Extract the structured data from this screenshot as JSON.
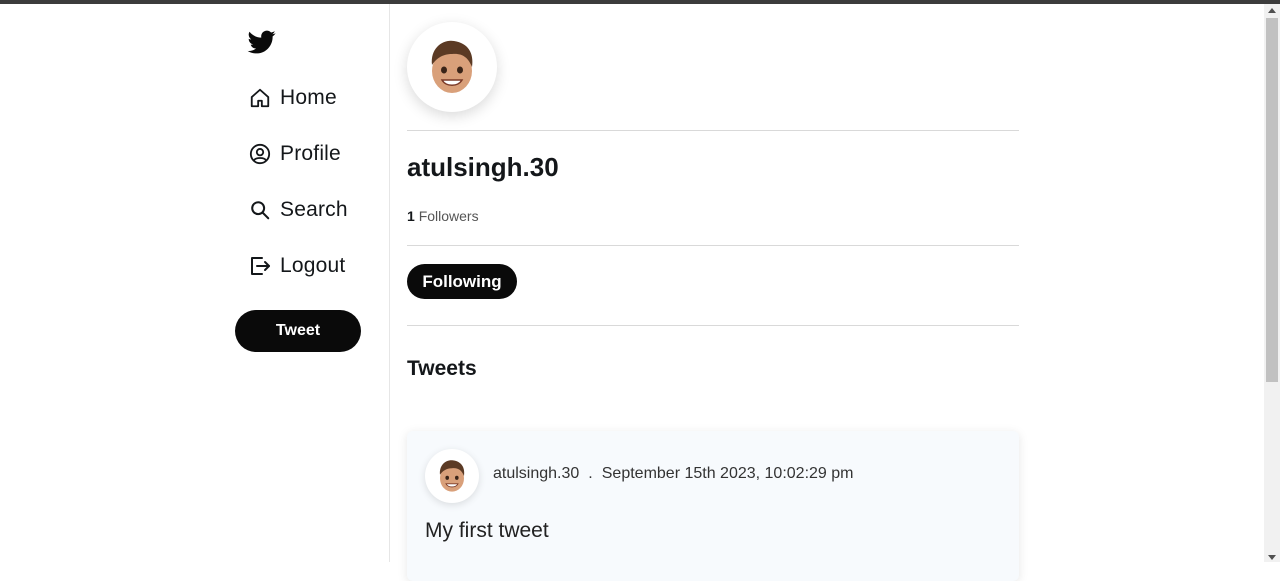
{
  "sidebar": {
    "logo_icon": "twitter-bird-icon",
    "items": [
      {
        "label": "Home",
        "icon": "home-icon"
      },
      {
        "label": "Profile",
        "icon": "user-circle-icon"
      },
      {
        "label": "Search",
        "icon": "search-icon"
      },
      {
        "label": "Logout",
        "icon": "logout-icon"
      }
    ],
    "tweet_button": "Tweet"
  },
  "profile": {
    "username": "atulsingh.30",
    "followers_count": "1",
    "followers_label": "Followers",
    "follow_button": "Following"
  },
  "tweets": {
    "title": "Tweets",
    "items": [
      {
        "author": "atulsingh.30",
        "separator": ".",
        "timestamp": "September 15th 2023, 10:02:29 pm",
        "text": "My first tweet"
      }
    ]
  },
  "colors": {
    "accent": "#0a0a0a",
    "card_bg": "#f7fafd"
  }
}
